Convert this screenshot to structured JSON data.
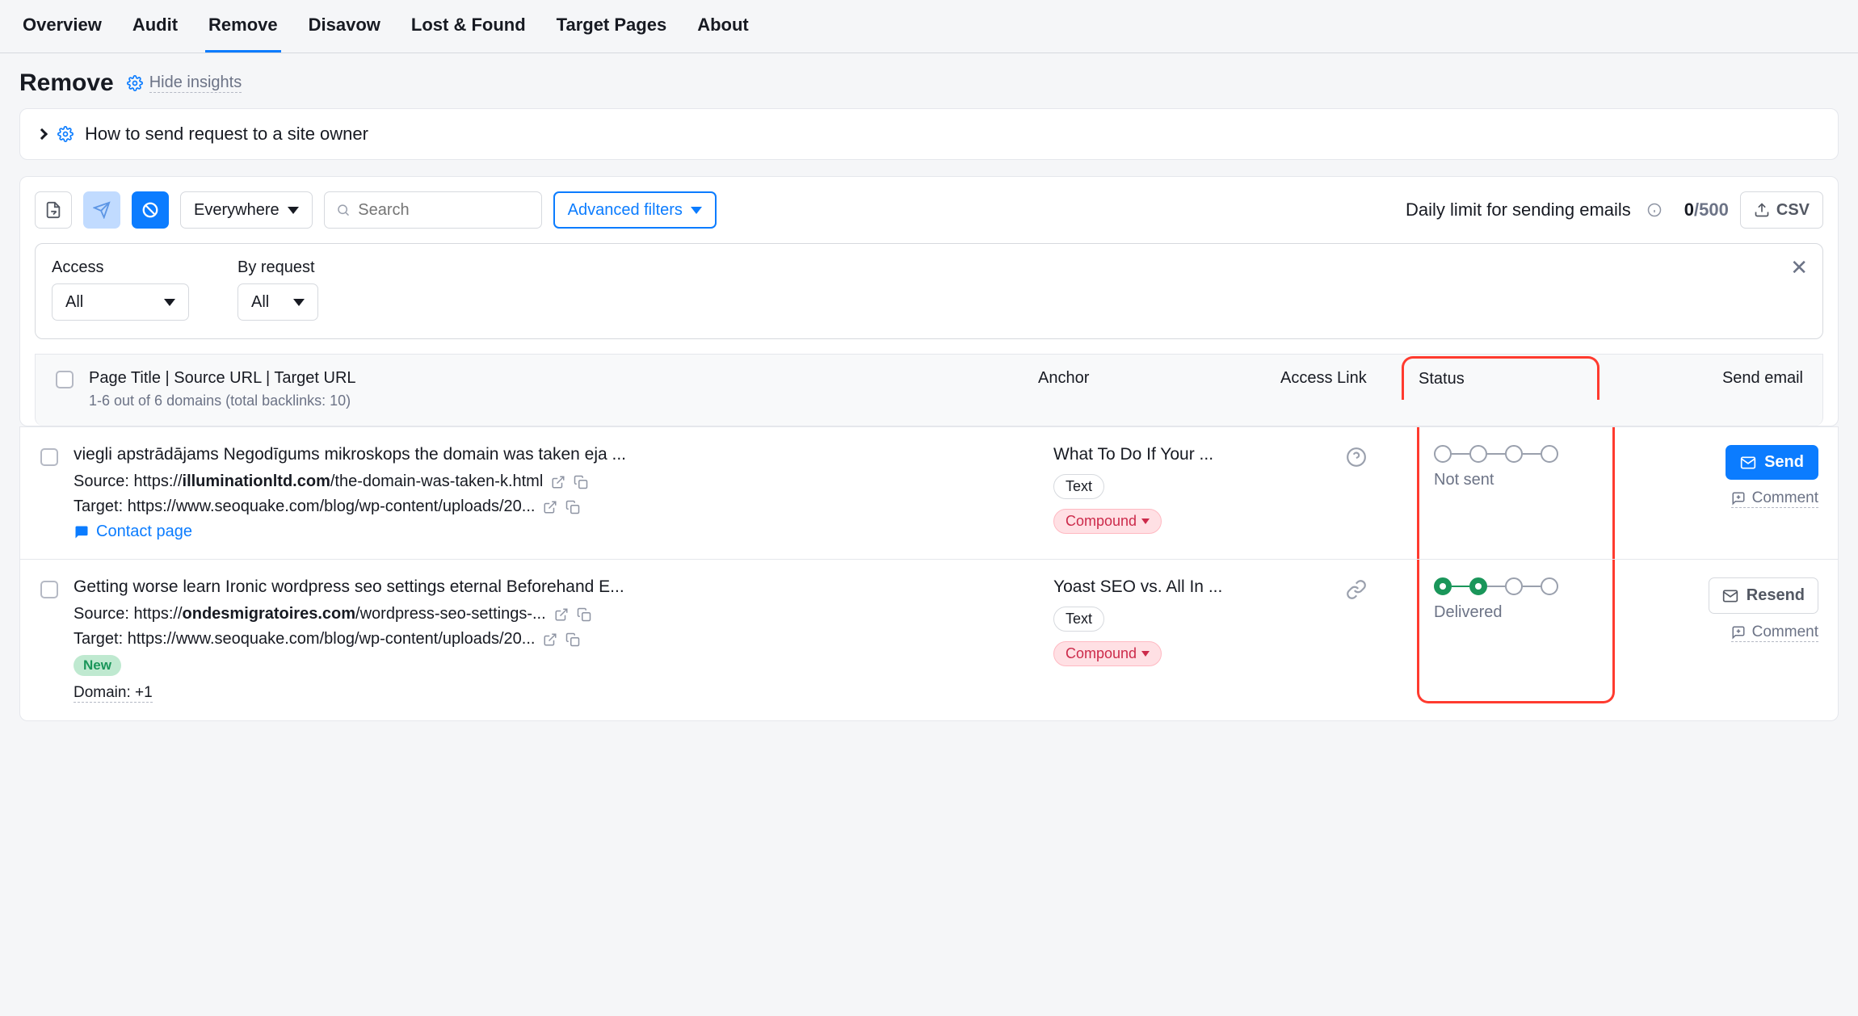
{
  "nav": {
    "tabs": [
      "Overview",
      "Audit",
      "Remove",
      "Disavow",
      "Lost & Found",
      "Target Pages",
      "About"
    ],
    "active": "Remove"
  },
  "header": {
    "title": "Remove",
    "hide_insights": "Hide insights"
  },
  "insight": {
    "text": "How to send request to a site owner"
  },
  "toolbar": {
    "scope": "Everywhere",
    "search_placeholder": "Search",
    "adv_filters": "Advanced filters",
    "daily_limit_label": "Daily limit for sending emails",
    "daily_used": "0",
    "daily_total": "/500",
    "csv": "CSV"
  },
  "filters": {
    "access_label": "Access",
    "access_value": "All",
    "request_label": "By request",
    "request_value": "All"
  },
  "table": {
    "col_page": "Page Title | Source URL | Target URL",
    "col_page_sub": "1-6 out of 6 domains (total backlinks: 10)",
    "col_anchor": "Anchor",
    "col_access": "Access Link",
    "col_status": "Status",
    "col_send": "Send email"
  },
  "rows": [
    {
      "title": "viegli apstrādājams Negodīgums mikroskops the domain was taken eja ...",
      "source_prefix": "Source: ",
      "source_proto": "https://",
      "source_domain": "illuminationltd.com",
      "source_path": "/the-domain-was-taken-k.html",
      "target_prefix": "Target: ",
      "target_url": "https://www.seoquake.com/blog/wp-content/uploads/20...",
      "contact": "Contact page",
      "anchor": "What To Do If Your ...",
      "tag_text": "Text",
      "tag_compound": "Compound",
      "access_icon": "question",
      "status": "Not sent",
      "progress_filled": 0,
      "action": "Send",
      "comment": "Comment"
    },
    {
      "title": "Getting worse learn Ironic wordpress seo settings eternal Beforehand E...",
      "source_prefix": "Source: ",
      "source_proto": "https://",
      "source_domain": "ondesmigratoires.com",
      "source_path": "/wordpress-seo-settings-...",
      "target_prefix": "Target: ",
      "target_url": "https://www.seoquake.com/blog/wp-content/uploads/20...",
      "new_badge": "New",
      "domain_plus": "Domain: +1",
      "anchor": "Yoast SEO vs. All In ...",
      "tag_text": "Text",
      "tag_compound": "Compound",
      "access_icon": "link",
      "status": "Delivered",
      "progress_filled": 2,
      "action": "Resend",
      "comment": "Comment"
    }
  ]
}
